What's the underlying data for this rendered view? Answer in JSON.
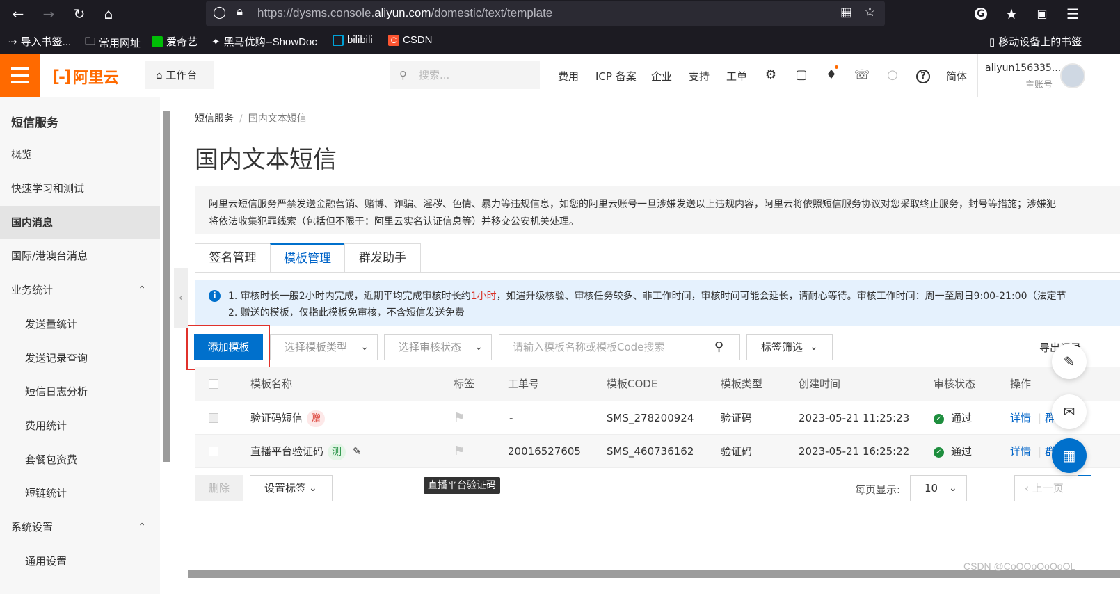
{
  "browser": {
    "url_prefix": "https://dysms.console.",
    "url_domain": "aliyun.com",
    "url_suffix": "/domestic/text/template",
    "bookmarks": [
      "导入书签...",
      "常用网址",
      "爱奇艺",
      "黑马优购--ShowDoc",
      "bilibili",
      "CSDN"
    ],
    "mobile_bookmarks": "移动设备上的书签"
  },
  "header": {
    "logo": "阿里云",
    "workbench": "工作台",
    "search_placeholder": "搜索...",
    "nav": [
      "费用",
      "ICP 备案",
      "企业",
      "支持",
      "工单"
    ],
    "lang": "简体",
    "username": "aliyun156335...",
    "account_type": "主账号"
  },
  "sidebar": {
    "title": "短信服务",
    "items": [
      {
        "label": "概览",
        "sub": false
      },
      {
        "label": "快速学习和测试",
        "sub": false
      },
      {
        "label": "国内消息",
        "sub": false,
        "active": true
      },
      {
        "label": "国际/港澳台消息",
        "sub": false
      },
      {
        "label": "业务统计",
        "sub": false,
        "expanded": true
      },
      {
        "label": "发送量统计",
        "sub": true
      },
      {
        "label": "发送记录查询",
        "sub": true
      },
      {
        "label": "短信日志分析",
        "sub": true
      },
      {
        "label": "费用统计",
        "sub": true
      },
      {
        "label": "套餐包资费",
        "sub": true
      },
      {
        "label": "短链统计",
        "sub": true
      },
      {
        "label": "系统设置",
        "sub": false,
        "expanded": true
      },
      {
        "label": "通用设置",
        "sub": true
      }
    ]
  },
  "main": {
    "breadcrumb": [
      "短信服务",
      "国内文本短信"
    ],
    "title": "国内文本短信",
    "warning_line1": "阿里云短信服务严禁发送金融营销、赌博、诈骗、淫秽、色情、暴力等违规信息，如您的阿里云账号一旦涉嫌发送以上违规内容，阿里云将依照短信服务协议对您采取终止服务，封号等措施；涉嫌犯",
    "warning_line2": "将依法收集犯罪线索（包括但不限于：阿里云实名认证信息等）并移交公安机关处理。",
    "tabs": [
      "签名管理",
      "模板管理",
      "群发助手"
    ],
    "active_tab": 1,
    "notice_l1_a": "1. 审核时长一般2小时内完成，近期平均完成审核时长约",
    "notice_l1_red": "1小时",
    "notice_l1_b": "，如遇升级核验、审核任务较多、非工作时间，审核时间可能会延长，请耐心等待。审核工作时间：周一至周日9:00-21:00（法定节",
    "notice_l2": "2. 赠送的模板，仅指此模板免审核，不含短信发送免费",
    "add_button": "添加模板",
    "type_select": "选择模板类型",
    "status_select": "选择审核状态",
    "search_placeholder": "请输入模板名称或模板Code搜索",
    "tag_filter": "标签筛选",
    "export": "导出记录",
    "columns": [
      "模板名称",
      "标签",
      "工单号",
      "模板CODE",
      "模板类型",
      "创建时间",
      "审核状态",
      "操作"
    ],
    "rows": [
      {
        "name": "验证码短信",
        "badge": "赠",
        "ticket": "-",
        "code": "SMS_278200924",
        "type": "验证码",
        "created": "2023-05-21 11:25:23",
        "status": "通过",
        "action": "详情",
        "action2": "群"
      },
      {
        "name": "直播平台验证码",
        "badge": "测",
        "ticket": "20016527605",
        "code": "SMS_460736162",
        "type": "验证码",
        "created": "2023-05-21 16:25:22",
        "status": "通过",
        "action": "详情",
        "action2": "群"
      }
    ],
    "delete": "删除",
    "set_tag": "设置标签",
    "tooltip": "直播平台验证码",
    "per_page_label": "每页显示:",
    "per_page": "10",
    "prev": "上一页"
  },
  "watermark": "CSDN @CoOOoOoOoOL",
  "colors": {
    "brand": "#ff6a00",
    "primary": "#0070cc",
    "success": "#1e8e3e",
    "danger": "#e0312b"
  }
}
